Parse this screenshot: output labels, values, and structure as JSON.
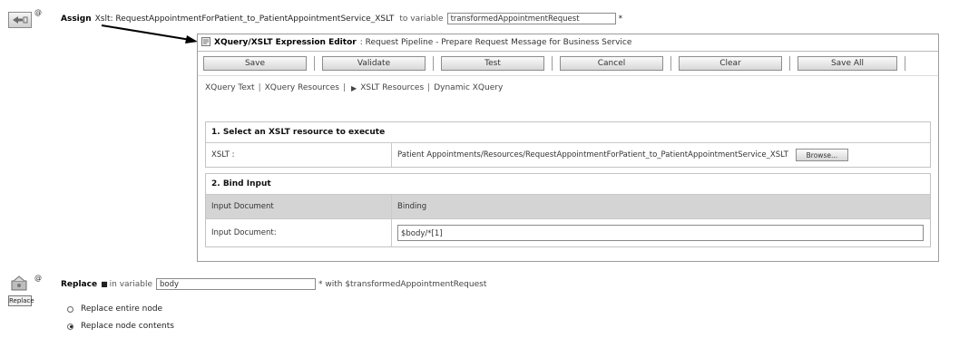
{
  "assign": {
    "keyword": "Assign",
    "text": "Xslt: RequestAppointmentForPatient_to_PatientAppointmentService_XSLT",
    "to_variable": "to variable",
    "variable_value": "transformedAppointmentRequest",
    "required_mark": "*",
    "at_badge": "@"
  },
  "editor": {
    "title": "XQuery/XSLT Expression Editor",
    "subtitle": ": Request Pipeline - Prepare Request Message for Business Service",
    "buttons": {
      "save": "Save",
      "validate": "Validate",
      "test": "Test",
      "cancel": "Cancel",
      "clear": "Clear",
      "save_all": "Save All"
    },
    "nav": {
      "xquery_text": "XQuery Text",
      "xquery_resources": "XQuery Resources",
      "xslt_resources": "XSLT Resources",
      "dynamic_xquery": "Dynamic XQuery",
      "separator": "|"
    },
    "section1": {
      "header": "1. Select an XSLT resource to execute",
      "xslt_label": "XSLT :",
      "xslt_value": "Patient Appointments/Resources/RequestAppointmentForPatient_to_PatientAppointmentService_XSLT",
      "browse": "Browse..."
    },
    "section2": {
      "header": "2. Bind Input",
      "col_input": "Input Document",
      "col_binding": "Binding",
      "row_label": "Input Document:",
      "row_value": "$body/*[1]"
    }
  },
  "replace": {
    "keyword": "Replace",
    "in_variable": "in variable",
    "variable_value": "body",
    "with_text": "* with $transformedAppointmentRequest",
    "icon_label": "Replace",
    "at_badge": "@",
    "option_entire": "Replace entire node",
    "option_contents": "Replace node contents",
    "selected": "Replace node contents"
  }
}
